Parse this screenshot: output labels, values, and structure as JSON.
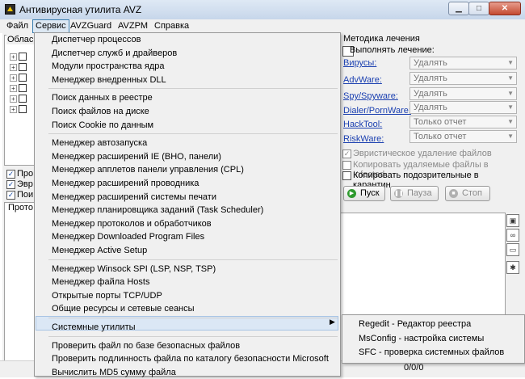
{
  "window": {
    "title": "Антивирусная утилита AVZ"
  },
  "menubar": [
    "Файл",
    "Сервис",
    "AVZGuard",
    "AVZPM",
    "Справка"
  ],
  "left": {
    "area_label": "Облас",
    "checkboxes": [
      "Про",
      "Эвр",
      "Пои"
    ],
    "protocol_label": "Прото"
  },
  "service_menu": {
    "groups": [
      [
        "Диспетчер процессов",
        "Диспетчер служб и драйверов",
        "Модули пространства ядра",
        "Менеджер внедренных DLL"
      ],
      [
        "Поиск данных  в реестре",
        "Поиск файлов на диске",
        "Поиск Cookie по данным"
      ],
      [
        "Менеджер автозапуска",
        "Менеджер расширений IE (BHO, панели)",
        "Менеджер апплетов панели управления (CPL)",
        "Менеджер расширений проводника",
        "Менеджер расширений системы печати",
        "Менеджер планировщика заданий (Task Scheduler)",
        "Менеджер протоколов и обработчиков",
        "Менеджер Downloaded Program Files",
        "Менеджер Active Setup"
      ],
      [
        "Менеджер Winsock SPI (LSP, NSP, TSP)",
        "Менеджер файла Hosts",
        "Открытые порты TCP/UDP",
        "Общие ресурсы и сетевые сеансы"
      ],
      [
        "Системные утилиты"
      ],
      [
        "Проверить файл по базе безопасных файлов",
        "Проверить подлинность файла по каталогу безопасности Microsoft",
        "Вычислить MD5 сумму файла"
      ]
    ]
  },
  "submenu": [
    "Regedit - Редактор реестра",
    "MsConfig - настройка системы",
    "SFC - проверка системных файлов"
  ],
  "right": {
    "title": "Методика лечения",
    "exec_label": "Выполнять лечение:",
    "rows": [
      {
        "label": "Вирусы:",
        "value": "Удалять"
      },
      {
        "label": "AdvWare:",
        "value": "Удалять"
      },
      {
        "label": "Spy/Spyware:",
        "value": "Удалять"
      },
      {
        "label": "Dialer/PornWare:",
        "value": "Удалять"
      },
      {
        "label": "HackTool:",
        "value": "Только отчет"
      },
      {
        "label": "RiskWare:",
        "value": "Только отчет"
      }
    ],
    "options": [
      {
        "label": "Эвристическое удаление файлов",
        "checked": true,
        "enabled": false
      },
      {
        "label": "Копировать удаляемые файлы в  Infected",
        "checked": false,
        "enabled": false
      },
      {
        "label": "Копировать подозрительные в  карантин",
        "checked": false,
        "enabled": true
      }
    ],
    "buttons": {
      "start": "Пуск",
      "pause": "Пауза",
      "stop": "Стоп"
    },
    "counter": "0/0/0"
  },
  "colors": {
    "accent": "#1a3fb0",
    "highlight": "#dbe7f5",
    "start_green": "#2e9a2e"
  }
}
